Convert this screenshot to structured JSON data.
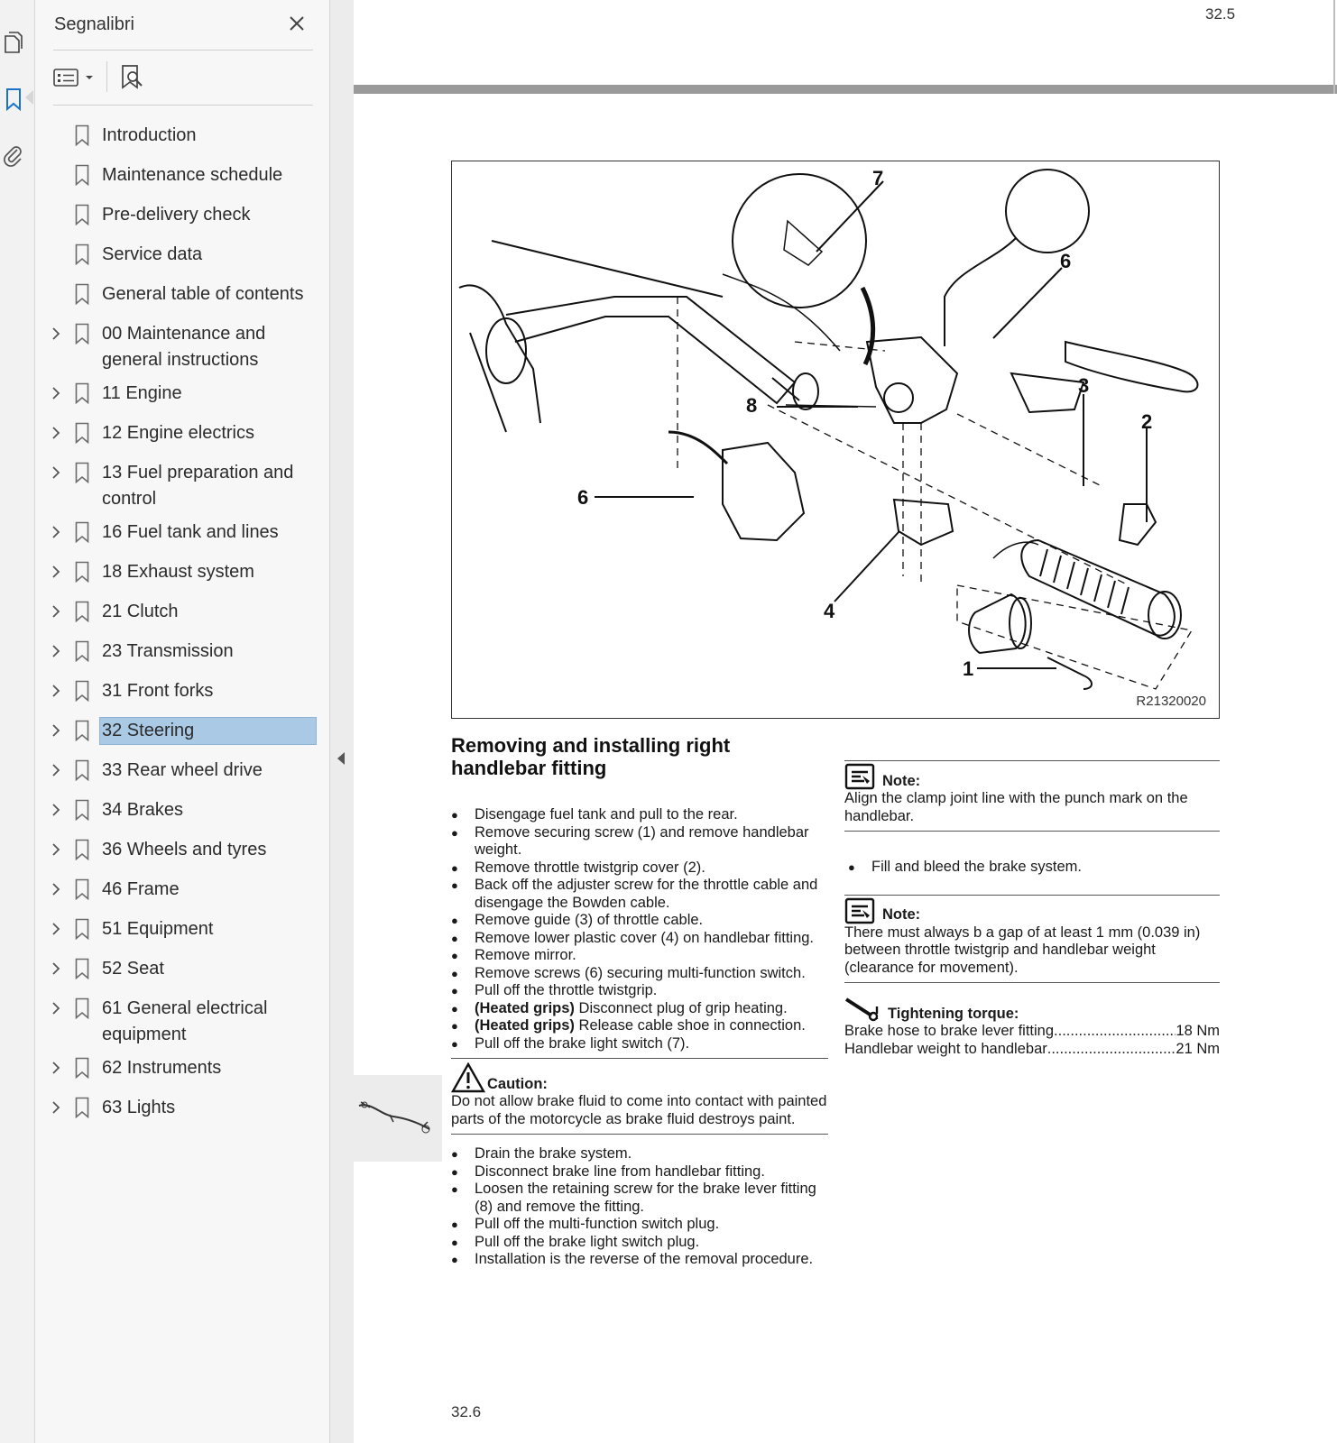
{
  "sidebar": {
    "title": "Segnalibri",
    "bookmarks": [
      {
        "label": "Introduction",
        "expandable": false
      },
      {
        "label": "Maintenance schedule",
        "expandable": false
      },
      {
        "label": "Pre-delivery check",
        "expandable": false
      },
      {
        "label": "Service data",
        "expandable": false
      },
      {
        "label": "General table of contents",
        "expandable": false
      },
      {
        "label": "00 Maintenance and general instructions",
        "expandable": true
      },
      {
        "label": "11 Engine",
        "expandable": true
      },
      {
        "label": "12 Engine electrics",
        "expandable": true
      },
      {
        "label": "13 Fuel preparation and control",
        "expandable": true
      },
      {
        "label": "16 Fuel tank and lines",
        "expandable": true
      },
      {
        "label": "18 Exhaust system",
        "expandable": true
      },
      {
        "label": "21 Clutch",
        "expandable": true
      },
      {
        "label": "23 Transmission",
        "expandable": true
      },
      {
        "label": "31 Front forks",
        "expandable": true
      },
      {
        "label": "32 Steering",
        "expandable": true,
        "selected": true
      },
      {
        "label": "33 Rear wheel drive",
        "expandable": true
      },
      {
        "label": "34 Brakes",
        "expandable": true
      },
      {
        "label": "36 Wheels and tyres",
        "expandable": true
      },
      {
        "label": "46 Frame",
        "expandable": true
      },
      {
        "label": "51 Equipment",
        "expandable": true
      },
      {
        "label": "52 Seat",
        "expandable": true
      },
      {
        "label": "61 General electrical equipment",
        "expandable": true
      },
      {
        "label": "62 Instruments",
        "expandable": true
      },
      {
        "label": "63 Lights",
        "expandable": true
      }
    ]
  },
  "page": {
    "top_page_number": "32.5",
    "bottom_page_number": "32.6",
    "figure": {
      "code": "R21320020",
      "callouts": [
        "7",
        "6",
        "8",
        "3",
        "2",
        "6",
        "4",
        "1"
      ]
    },
    "left": {
      "heading": "Removing and installing right handlebar fitting",
      "steps1": [
        "Disengage fuel tank and pull to the rear.",
        "Remove securing screw (1) and remove handlebar weight.",
        "Remove throttle twistgrip cover (2).",
        "Back off the adjuster screw for the throttle cable and disengage the Bowden cable.",
        "Remove guide (3) of throttle cable.",
        "Remove lower plastic cover (4) on handlebar fitting.",
        "Remove mirror.",
        "Remove screws (6) securing multi-function switch.",
        "Pull off the throttle twistgrip."
      ],
      "heated1_bold": "(Heated grips)",
      "heated1_text": " Disconnect plug of grip heating.",
      "heated2_bold": "(Heated grips)",
      "heated2_text": " Release cable shoe in connection.",
      "step_brake_switch": "Pull off the brake light switch (7).",
      "caution_title": "Caution:",
      "caution_text": "Do not allow brake fluid to come into contact with painted parts of the motorcycle as brake fluid destroys paint.",
      "steps2": [
        "Drain the brake system.",
        "Disconnect brake line from handlebar fitting.",
        "Loosen the retaining screw for the brake lever fitting (8) and remove the fitting.",
        "Pull off the multi-function switch plug.",
        "Pull off the brake light switch plug.",
        "Installation is the reverse of the removal procedure."
      ]
    },
    "right": {
      "note1_title": "Note:",
      "note1_text": "Align the clamp joint line with the punch mark on the handlebar.",
      "step_fill": "Fill and bleed the brake system.",
      "note2_title": "Note:",
      "note2_text": "There must always b a gap of at least 1 mm (0.039 in) between throttle twistgrip and handlebar weight (clearance for movement).",
      "torque_title": "Tightening torque:",
      "torque_rows": [
        {
          "label": "Brake hose to brake lever fitting",
          "value": "18 Nm"
        },
        {
          "label": "Handlebar weight to handlebar ",
          "value": "21 Nm"
        }
      ]
    }
  },
  "colors": {
    "selection": "#a9c9e4",
    "accent": "#1a73c8",
    "bar": "#9a9a9a"
  }
}
